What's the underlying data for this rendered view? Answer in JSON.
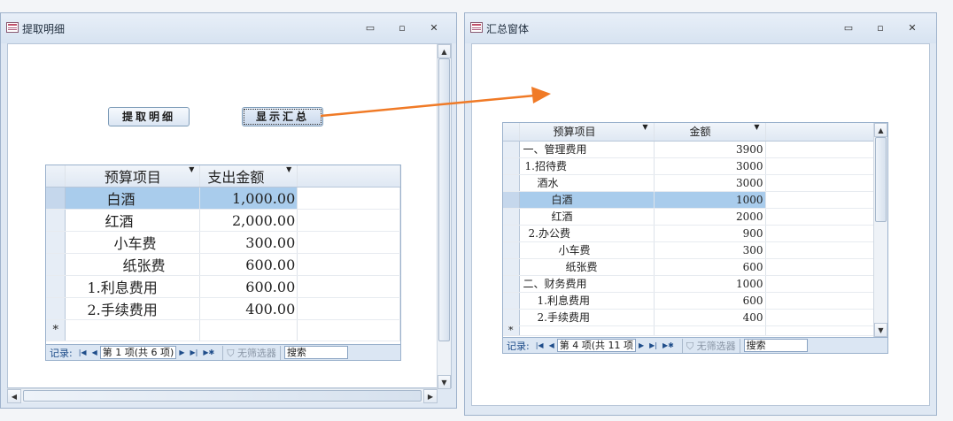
{
  "left_window": {
    "title": "提取明细",
    "controls": {
      "minimize": "▭",
      "restore": "▫",
      "close": "✕"
    },
    "buttons": {
      "extract": "提取明细",
      "show_summary": "显示汇总"
    },
    "grid": {
      "headers": [
        "预算项目",
        "支出金额"
      ],
      "rows": [
        {
          "item": "白酒",
          "amount": "1,000.00"
        },
        {
          "item": "红酒",
          "amount": "2,000.00"
        },
        {
          "item": "小车费",
          "amount": "300.00"
        },
        {
          "item": "纸张费",
          "amount": "600.00"
        },
        {
          "item": "1.利息费用",
          "amount": "600.00"
        },
        {
          "item": "2.手续费用",
          "amount": "400.00"
        }
      ],
      "new_row_marker": "*",
      "nav": {
        "records_label": "记录:",
        "position": "第 1 项(共 6 项)",
        "filter": "无筛选器",
        "search": "搜索"
      }
    }
  },
  "right_window": {
    "title": "汇总窗体",
    "controls": {
      "minimize": "▭",
      "restore": "▫",
      "close": "✕"
    },
    "grid": {
      "headers": [
        "预算项目",
        "金额"
      ],
      "rows": [
        {
          "item": "一、管理费用",
          "amount": "3900"
        },
        {
          "item": "1.招待费",
          "amount": "3000"
        },
        {
          "item": "酒水",
          "amount": "3000"
        },
        {
          "item": "白酒",
          "amount": "1000"
        },
        {
          "item": "红酒",
          "amount": "2000"
        },
        {
          "item": "2.办公费",
          "amount": "900"
        },
        {
          "item": "小车费",
          "amount": "300"
        },
        {
          "item": "纸张费",
          "amount": "600"
        },
        {
          "item": "二、财务费用",
          "amount": "1000"
        },
        {
          "item": "1.利息费用",
          "amount": "600"
        },
        {
          "item": "2.手续费用",
          "amount": "400"
        }
      ],
      "new_row_marker": "*",
      "nav": {
        "records_label": "记录:",
        "position": "第 4 项(共 11 项",
        "filter": "无筛选器",
        "search": "搜索"
      }
    }
  },
  "colors": {
    "arrow": "#f07a26",
    "selection": "#a9ccec",
    "header_blue": "#dbe6f3"
  }
}
